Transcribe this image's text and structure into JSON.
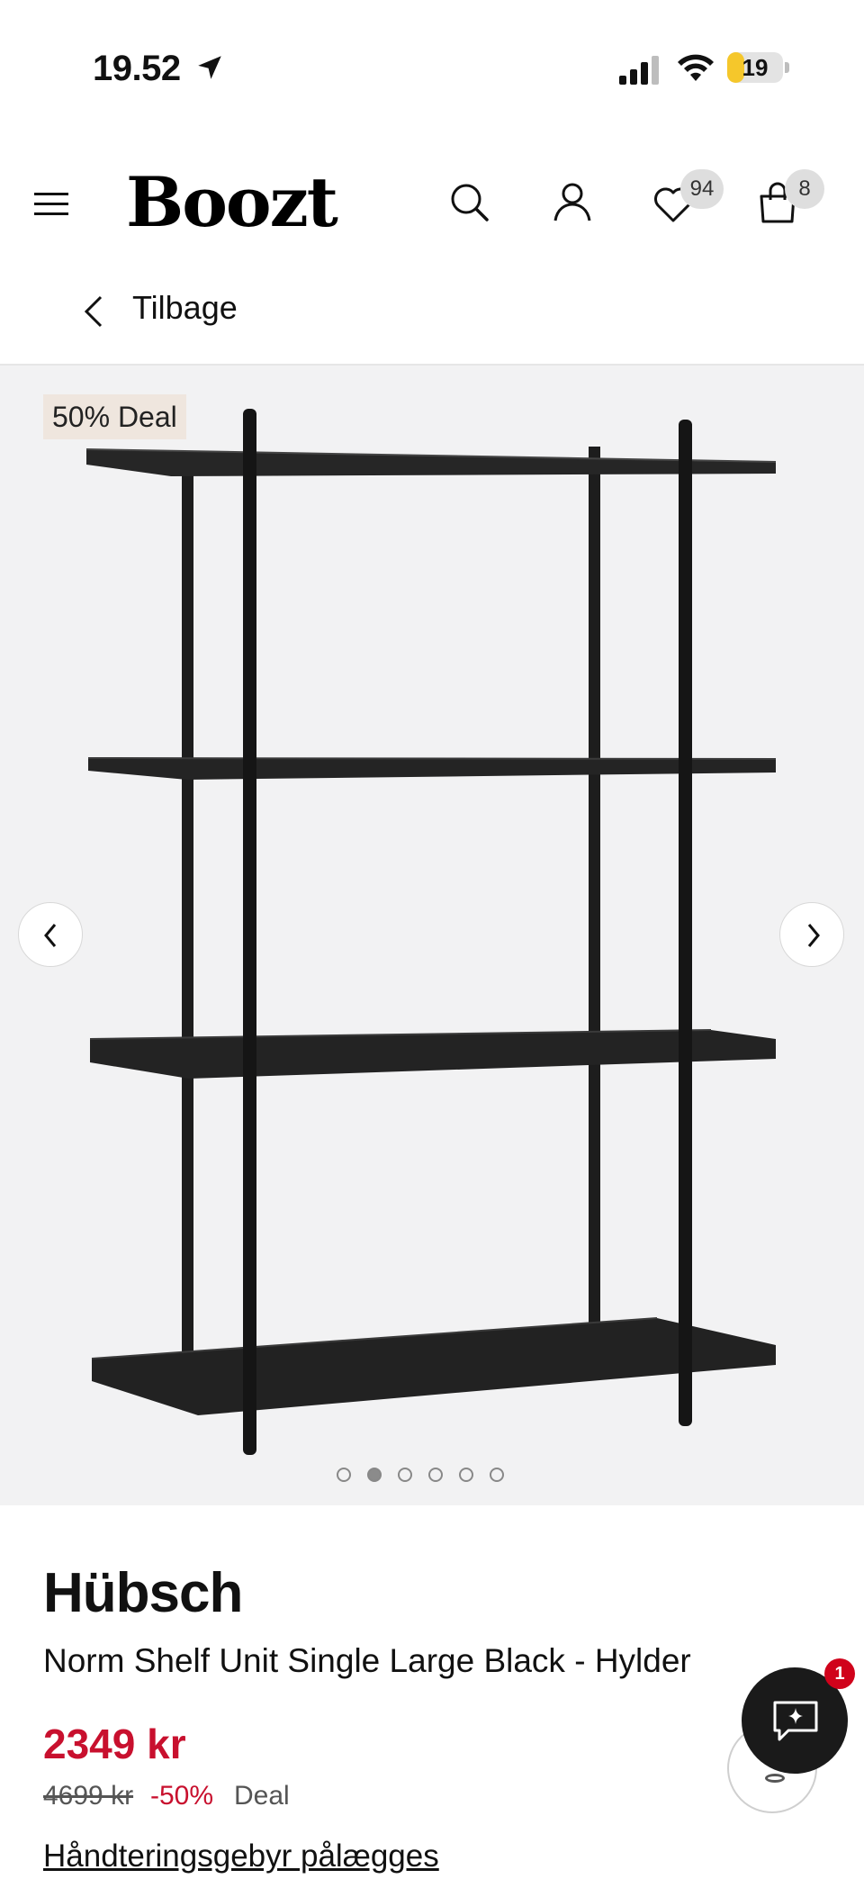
{
  "status_bar": {
    "time": "19.52",
    "battery_level": "19",
    "icons": [
      "location-arrow-icon",
      "cellular-signal-icon",
      "wifi-icon",
      "battery-icon"
    ]
  },
  "header": {
    "logo": "Boozt",
    "icons": [
      "menu-icon",
      "search-icon",
      "user-icon",
      "heart-icon",
      "bag-icon"
    ],
    "wishlist_count": "94",
    "bag_count": "8"
  },
  "back": {
    "label": "Tilbage"
  },
  "gallery": {
    "deal_tag": "50% Deal",
    "image_count": 6,
    "active_index": 1,
    "background": "#f2f2f3"
  },
  "product": {
    "brand": "Hübsch",
    "name": "Norm Shelf Unit Single Large Black - Hylder",
    "price": "2349 kr",
    "original_price": "4699 kr",
    "discount": "-50%",
    "deal_label": "Deal",
    "fee_link": "Håndteringsgebyr pålægges"
  },
  "chat": {
    "badge": "1"
  },
  "colors": {
    "price_red": "#c8102e",
    "deal_tag_bg": "#efe6de",
    "chat_bg": "#1a1a1a"
  }
}
